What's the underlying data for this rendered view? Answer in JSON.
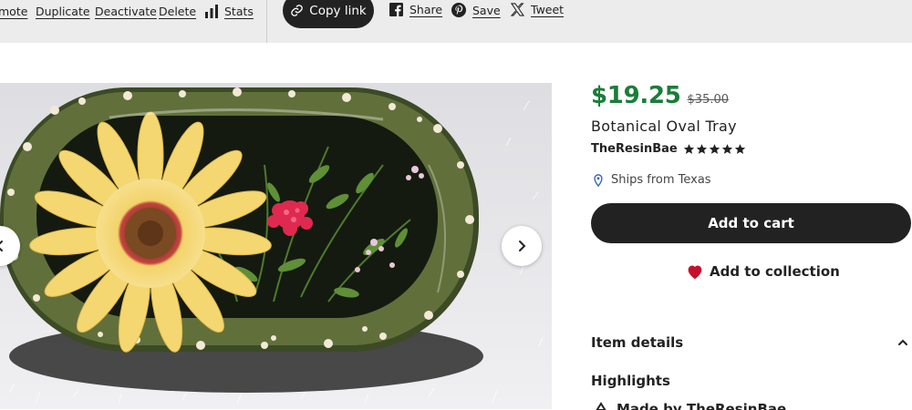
{
  "toolbar": {
    "promote_label": "mote",
    "duplicate_label": "Duplicate",
    "deactivate_label": "Deactivate",
    "delete_label": "Delete",
    "stats_label": "Stats",
    "copy_link_label": "Copy link",
    "share_label": "Share",
    "save_label": "Save",
    "tweet_label": "Tweet"
  },
  "product": {
    "price": "$19.25",
    "original_price": "$35.00",
    "title": "Botanical Oval Tray",
    "shop_name": "TheResinBae",
    "rating_stars": 5,
    "ships_from": "Ships from Texas",
    "add_to_cart_label": "Add to cart",
    "add_to_collection_label": "Add to collection",
    "item_details_label": "Item details",
    "highlights_label": "Highlights",
    "made_by": "Made by TheResinBae"
  },
  "gallery": {
    "image_description": "resin oval tray with yellow daisy and pink flowers"
  },
  "colors": {
    "price_green": "#1a7d3a",
    "button_dark": "#222222",
    "heart_red": "#c8102e",
    "toolbar_bg": "#ececec"
  },
  "icons": [
    "stats-icon",
    "link-icon",
    "facebook-icon",
    "pinterest-icon",
    "x-twitter-icon",
    "star-icon",
    "location-pin-icon",
    "heart-icon",
    "chevron-up-icon",
    "chevron-left-icon",
    "chevron-right-icon",
    "made-by-icon"
  ]
}
